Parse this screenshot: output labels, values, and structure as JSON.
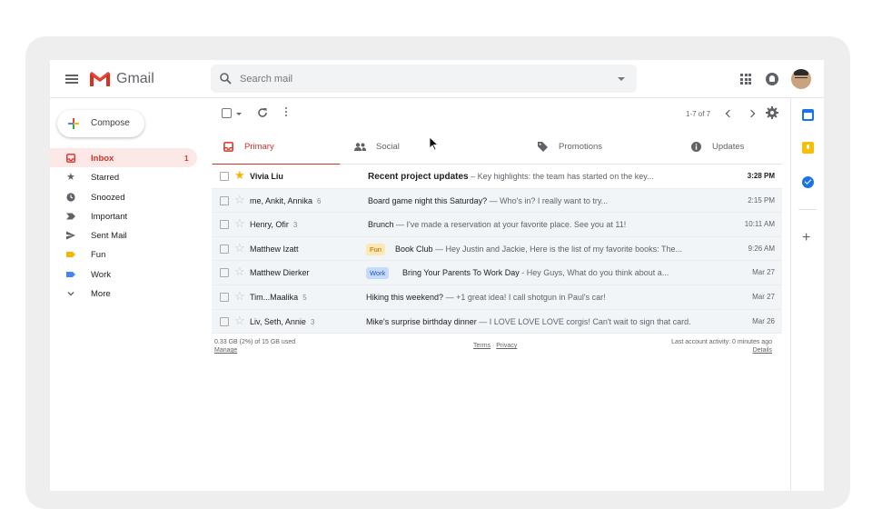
{
  "app": {
    "brand": "Gmail",
    "colors": {
      "accent": "#d93025",
      "star": "#f4b400",
      "fun_label": "#fce8b2",
      "work_label": "#c6dafc"
    }
  },
  "header": {
    "search_placeholder": "Search mail",
    "icons": [
      "menu-icon",
      "search-icon",
      "apps-grid-icon",
      "notifications-icon",
      "avatar"
    ]
  },
  "sidebar": {
    "compose_label": "Compose",
    "items": [
      {
        "label": "Inbox",
        "count": "1",
        "icon": "inbox-icon",
        "active": true
      },
      {
        "label": "Starred",
        "icon": "star-icon"
      },
      {
        "label": "Snoozed",
        "icon": "clock-icon"
      },
      {
        "label": "Important",
        "icon": "important-icon"
      },
      {
        "label": "Sent Mail",
        "icon": "send-icon"
      },
      {
        "label": "Fun",
        "icon": "label-icon",
        "color": "#f4b400"
      },
      {
        "label": "Work",
        "icon": "label-icon",
        "color": "#4285f4"
      },
      {
        "label": "More",
        "icon": "chevron-down-icon"
      }
    ]
  },
  "toolbar": {
    "pager": "1-7 of 7"
  },
  "tabs": [
    {
      "label": "Primary",
      "icon": "inbox-icon",
      "active": true
    },
    {
      "label": "Social",
      "icon": "people-icon"
    },
    {
      "label": "Promotions",
      "icon": "tag-icon"
    },
    {
      "label": "Updates",
      "icon": "info-icon"
    }
  ],
  "emails": [
    {
      "sender": "Vivia Liu",
      "count": "",
      "starred": true,
      "unread": true,
      "label": "",
      "subject": "Recent project updates",
      "snippet": " – Key highlights: the team has started on the key...",
      "date": "3:28 PM"
    },
    {
      "sender": "me, Ankit, Annika",
      "count": "6",
      "starred": false,
      "unread": false,
      "label": "",
      "subject": "Board game night this Saturday?",
      "snippet": " — Who's in? I really want to try...",
      "date": "2:15 PM"
    },
    {
      "sender": "Henry, Ofir",
      "count": "3",
      "starred": false,
      "unread": false,
      "label": "",
      "subject": "Brunch",
      "snippet": " — I've made a reservation at your favorite place. See you at 11!",
      "date": "10:11 AM"
    },
    {
      "sender": "Matthew Izatt",
      "count": "",
      "starred": false,
      "unread": false,
      "label": "Fun",
      "subject": "Book Club",
      "snippet": " — Hey Justin and Jackie, Here is the list of my favorite books: The...",
      "date": "9:26 AM"
    },
    {
      "sender": "Matthew Dierker",
      "count": "",
      "starred": false,
      "unread": false,
      "label": "Work",
      "subject": "Bring Your Parents To Work Day",
      "snippet": " - Hey Guys, What do you think about a...",
      "date": "Mar 27"
    },
    {
      "sender": "Tim...Maalika",
      "count": "5",
      "starred": false,
      "unread": false,
      "label": "",
      "subject": "Hiking this weekend?",
      "snippet": " — +1 great idea! I call shotgun in Paul's car!",
      "date": "Mar 27"
    },
    {
      "sender": "Liv, Seth, Annie",
      "count": "3",
      "starred": false,
      "unread": false,
      "label": "",
      "subject": "Mike's surprise birthday dinner",
      "snippet": " — I LOVE LOVE LOVE corgis! Can't wait to sign that card.",
      "date": "Mar 26"
    }
  ],
  "footer": {
    "storage": "0.33 GB (2%) of 15 GB used",
    "manage": "Manage",
    "terms": "Terms",
    "sep": " · ",
    "privacy": "Privacy",
    "activity": "Last account activity: 0 minutes ago",
    "details": "Details"
  },
  "side_panel": {
    "icons": [
      "calendar-icon",
      "keep-icon",
      "tasks-icon",
      "add-icon"
    ]
  }
}
